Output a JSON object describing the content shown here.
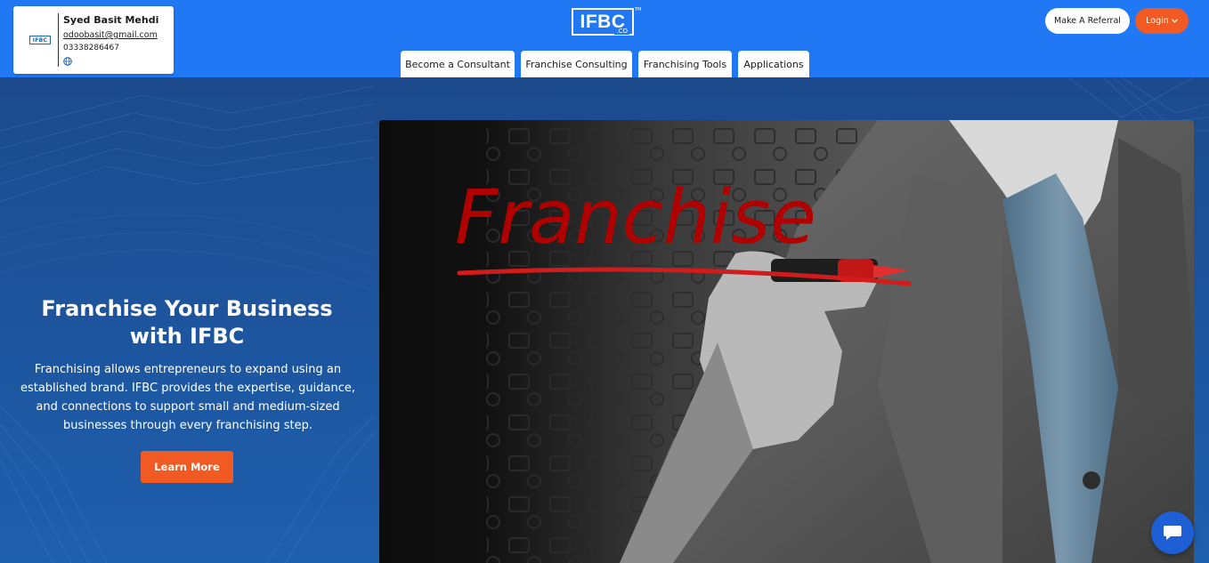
{
  "contact_card": {
    "logo_text": "IFBC",
    "name": "Syed Basit Mehdi",
    "email": "odoobasit@gmail.com",
    "phone": "03338286467",
    "icon": "globe-icon"
  },
  "header": {
    "logo_text": "IFBC",
    "logo_sub": ".CO",
    "logo_tm": "TM",
    "nav": [
      {
        "label": "Become a Consultant"
      },
      {
        "label": "Franchise Consulting"
      },
      {
        "label": "Franchising Tools"
      },
      {
        "label": "Applications"
      }
    ],
    "referral_label": "Make A Referral",
    "login_label": "Login",
    "login_icon": "chevron-down-icon"
  },
  "hero": {
    "title_line1": "Franchise Your Business",
    "title_line2": "with IFBC",
    "description": "Franchising allows entrepreneurs to expand using an established brand. IFBC provides the expertise, guidance, and connections to support small and medium-sized businesses through every franchising step.",
    "cta_label": "Learn More",
    "image_word": "Franchise"
  },
  "chat": {
    "icon": "chat-bubble-icon"
  },
  "colors": {
    "header_bg": "#2178f5",
    "hero_bg": "#1c4a8c",
    "accent": "#f15a22",
    "marker_red": "#b00000"
  }
}
